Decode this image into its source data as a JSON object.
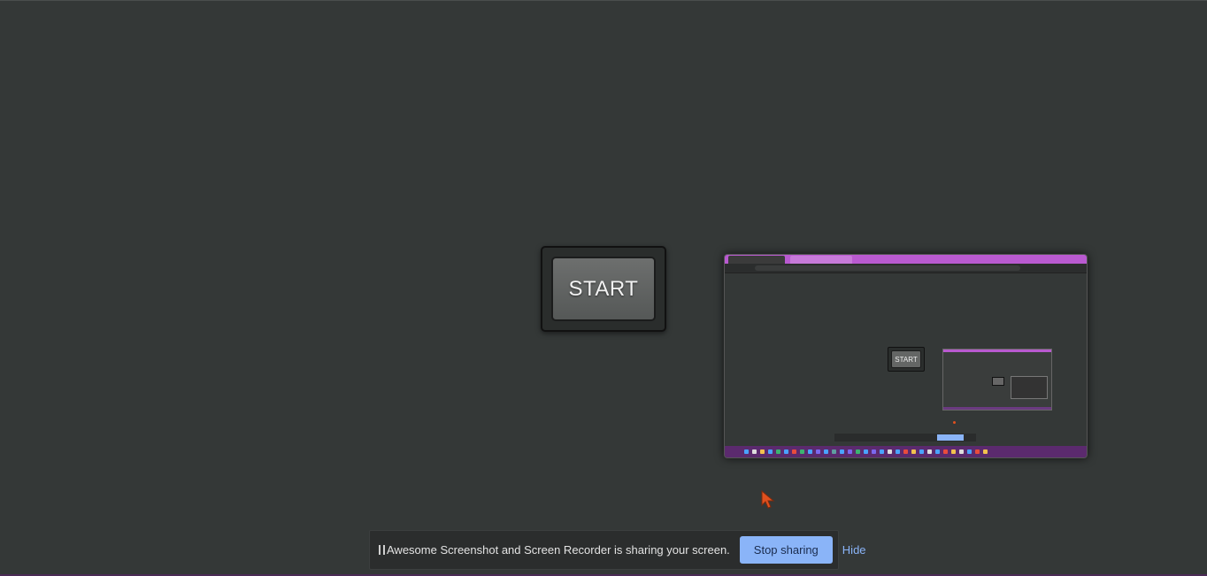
{
  "main": {
    "start_label": "START"
  },
  "preview": {
    "start_label": "START",
    "tab_color": "#b95ad0",
    "taskbar_color": "#5b2a6e"
  },
  "share_bar": {
    "pause_icon": "pause-icon",
    "message": "Awesome Screenshot and Screen Recorder is sharing your screen.",
    "stop_label": "Stop sharing",
    "hide_label": "Hide",
    "accent_color": "#8ab4f8"
  },
  "colors": {
    "background": "#343837",
    "cursor": "#e0501e"
  }
}
